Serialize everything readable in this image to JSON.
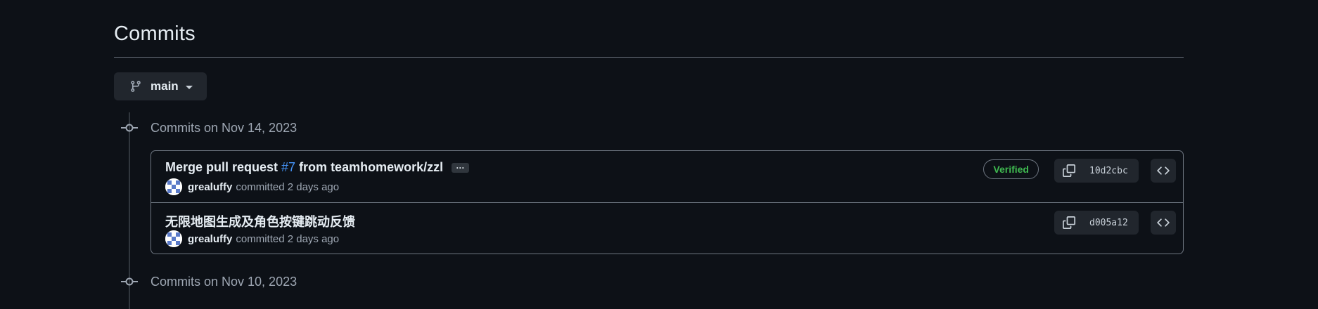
{
  "page": {
    "title": "Commits"
  },
  "branch": {
    "label": "main"
  },
  "groups": [
    {
      "heading": "Commits on Nov 14, 2023",
      "commits": [
        {
          "message_prefix": "Merge pull request",
          "pr_link": "#7",
          "message_suffix": "from teamhomework/zzl",
          "ellipsis": "···",
          "author": "grealuffy",
          "meta": "committed 2 days ago",
          "verified": "Verified",
          "sha": "10d2cbc"
        },
        {
          "message": "无限地图生成及角色按键跳动反馈",
          "author": "grealuffy",
          "meta": "committed 2 days ago",
          "sha": "d005a12"
        }
      ]
    },
    {
      "heading": "Commits on Nov 10, 2023"
    }
  ],
  "colors": {
    "background": "#0d1117",
    "link": "#4493f8",
    "verified": "#3fb950",
    "button": "#21262d"
  }
}
